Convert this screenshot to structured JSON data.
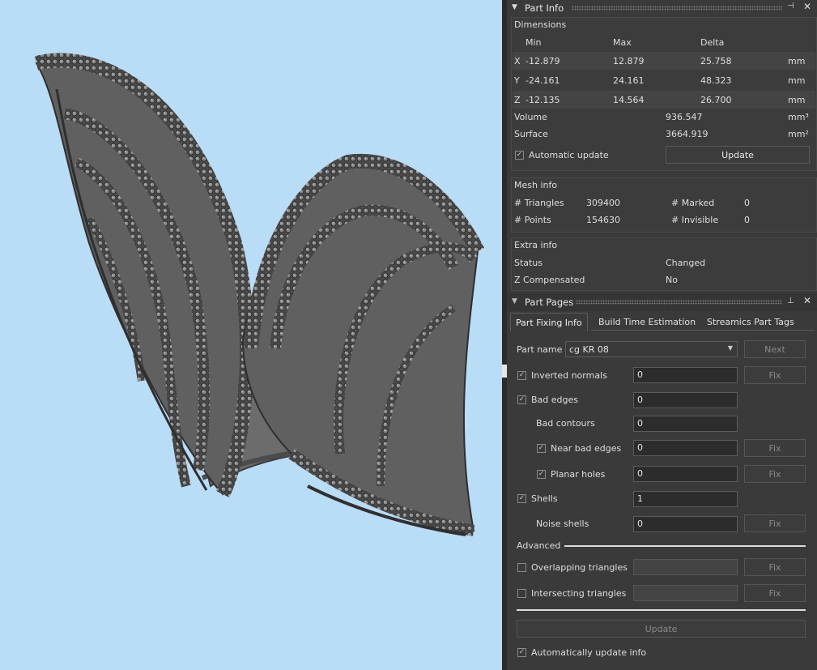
{
  "part_info": {
    "title": "Part Info",
    "dimensions": {
      "title": "Dimensions",
      "headers": [
        "Min",
        "Max",
        "Delta"
      ],
      "rows": [
        {
          "axis": "X",
          "min": "-12.879",
          "max": "12.879",
          "delta": "25.758",
          "unit": "mm"
        },
        {
          "axis": "Y",
          "min": "-24.161",
          "max": "24.161",
          "delta": "48.323",
          "unit": "mm"
        },
        {
          "axis": "Z",
          "min": "-12.135",
          "max": "14.564",
          "delta": "26.700",
          "unit": "mm"
        }
      ],
      "volume_label": "Volume",
      "volume_value": "936.547",
      "volume_unit": "mm³",
      "surface_label": "Surface",
      "surface_value": "3664.919",
      "surface_unit": "mm²",
      "auto_update_label": "Automatic update",
      "auto_update_checked": true,
      "update_button": "Update"
    },
    "mesh_info": {
      "title": "Mesh info",
      "triangles_label": "# Triangles",
      "triangles_value": "309400",
      "points_label": "# Points",
      "points_value": "154630",
      "marked_label": "# Marked",
      "marked_value": "0",
      "invisible_label": "# Invisible",
      "invisible_value": "0"
    },
    "extra_info": {
      "title": "Extra info",
      "status_label": "Status",
      "status_value": "Changed",
      "zcomp_label": "Z Compensated",
      "zcomp_value": "No"
    }
  },
  "part_pages": {
    "title": "Part Pages",
    "tabs": [
      "Part Fixing Info",
      "Build Time Estimation",
      "Streamics Part Tags"
    ],
    "active_tab": 0,
    "part_name_label": "Part name",
    "part_name_value": "cg KR 08",
    "next_button": "Next",
    "fix_label": "Fix",
    "checks": {
      "inverted_normals": {
        "label": "Inverted normals",
        "checked": true,
        "value": "0"
      },
      "bad_edges": {
        "label": "Bad edges",
        "checked": true,
        "value": "0"
      },
      "bad_contours": {
        "label": "Bad contours",
        "value": "0"
      },
      "near_bad_edges": {
        "label": "Near bad edges",
        "checked": true,
        "value": "0"
      },
      "planar_holes": {
        "label": "Planar holes",
        "checked": true,
        "value": "0"
      },
      "shells": {
        "label": "Shells",
        "checked": true,
        "value": "1"
      },
      "noise_shells": {
        "label": "Noise shells",
        "value": "0"
      }
    },
    "advanced_label": "Advanced",
    "overlapping": {
      "label": "Overlapping triangles",
      "checked": false
    },
    "intersecting": {
      "label": "Intersecting triangles",
      "checked": false
    },
    "update_button": "Update",
    "auto_update_info_label": "Automatically update info",
    "auto_update_info_checked": true
  },
  "colors": {
    "viewport_bg": "#b9dcf7",
    "panel_bg": "#3a3a3a",
    "model": "#5a5a5a"
  }
}
